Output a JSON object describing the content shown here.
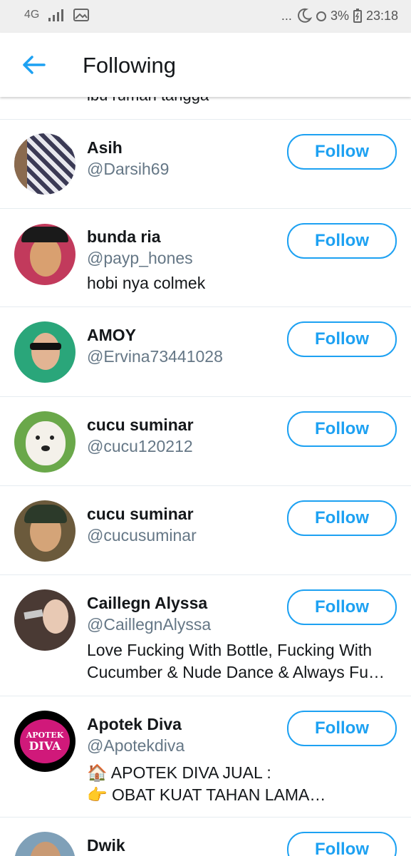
{
  "status_bar": {
    "network": "4G",
    "battery": "3%",
    "time": "23:18",
    "more": "..."
  },
  "header": {
    "title": "Following"
  },
  "clipped_bio": "ibu rumah tangga",
  "users": [
    {
      "name": "Asih",
      "handle": "@Darsih69",
      "bio": "",
      "follow_label": "Follow"
    },
    {
      "name": "bunda ria",
      "handle": "@payp_hones",
      "bio": "hobi nya colmek",
      "follow_label": "Follow"
    },
    {
      "name": "AMOY",
      "handle": "@Ervina73441028",
      "bio": "",
      "follow_label": "Follow"
    },
    {
      "name": "cucu suminar",
      "handle": "@cucu120212",
      "bio": "",
      "follow_label": "Follow"
    },
    {
      "name": "cucu suminar",
      "handle": "@cucusuminar",
      "bio": "",
      "follow_label": "Follow"
    },
    {
      "name": "Caillegn Alyssa",
      "handle": "@CaillegnAlyssa",
      "bio": "Love Fucking With Bottle, Fucking With Cucumber & Nude Dance & Always Fu…",
      "follow_label": "Follow"
    },
    {
      "name": "Apotek Diva",
      "handle": "@Apotekdiva",
      "bio_line1": "🏠 APOTEK DIVA JUAL :",
      "bio_line2": "👉 OBAT KUAT TAHAN LAMA…",
      "follow_label": "Follow",
      "logo_text_1": "APOTEK",
      "logo_text_2": "DIVA"
    },
    {
      "name": "Dwik",
      "handle": "",
      "bio": "",
      "follow_label": "Follow"
    }
  ]
}
